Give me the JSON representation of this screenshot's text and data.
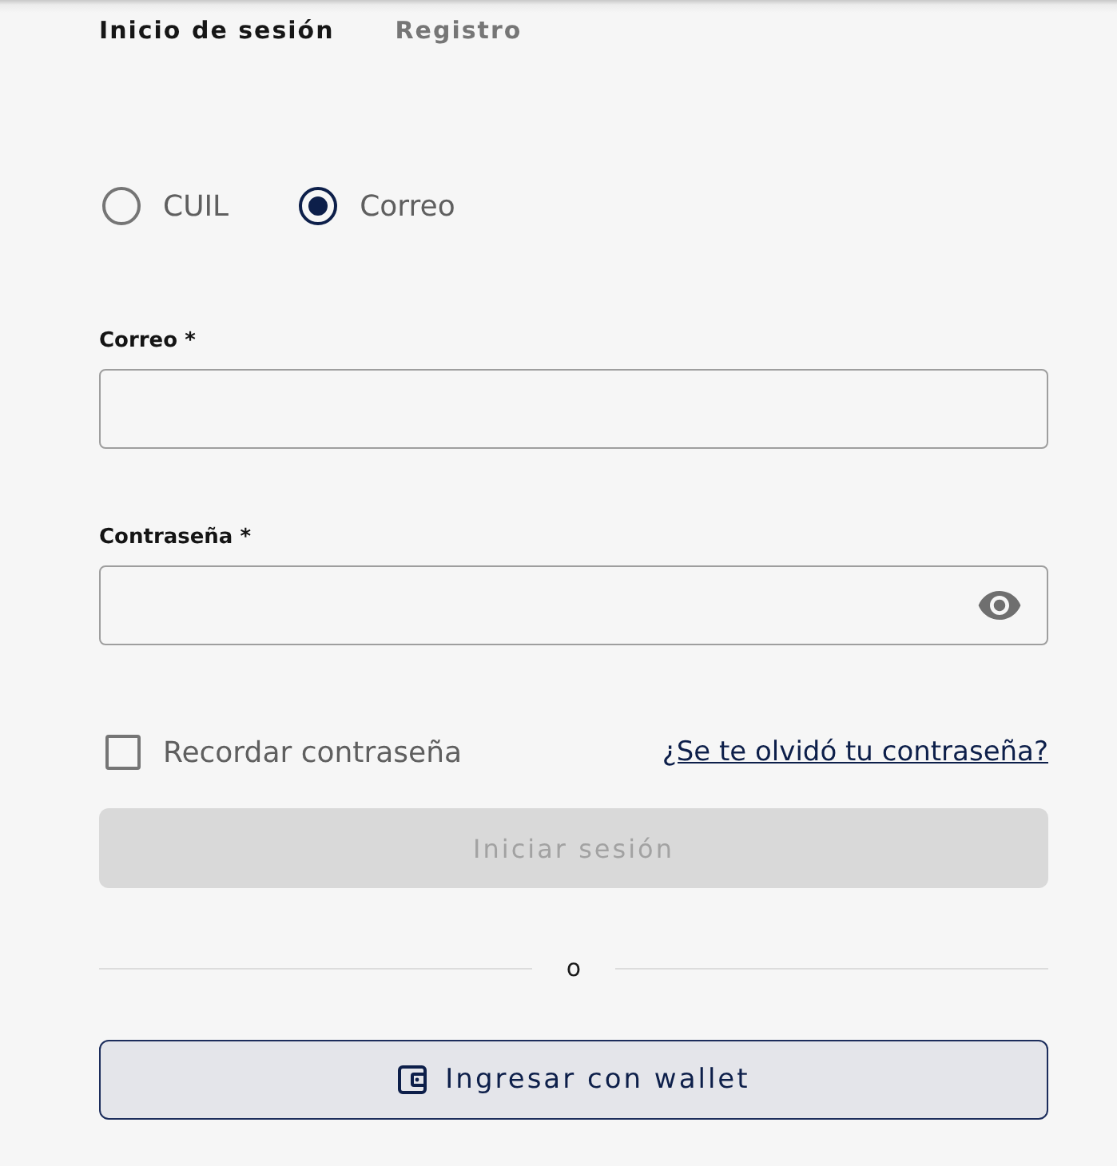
{
  "tabs": [
    {
      "label": "Inicio de sesión",
      "selected": true
    },
    {
      "label": "Registro",
      "selected": false
    }
  ],
  "login_method": [
    {
      "label": "CUIL",
      "selected": false
    },
    {
      "label": "Correo",
      "selected": true
    }
  ],
  "fields": [
    {
      "label": "Correo *",
      "kind": "text"
    },
    {
      "label": "Contraseña *",
      "kind": "password"
    }
  ],
  "remember": {
    "label": "Recordar contraseña",
    "checked": false
  },
  "forgot_link": "¿Se te olvidó tu contraseña?",
  "submit": {
    "label": "Iniciar sesión",
    "disabled": true
  },
  "divider": "o",
  "wallet_button": {
    "label": "Ingresar con wallet"
  }
}
